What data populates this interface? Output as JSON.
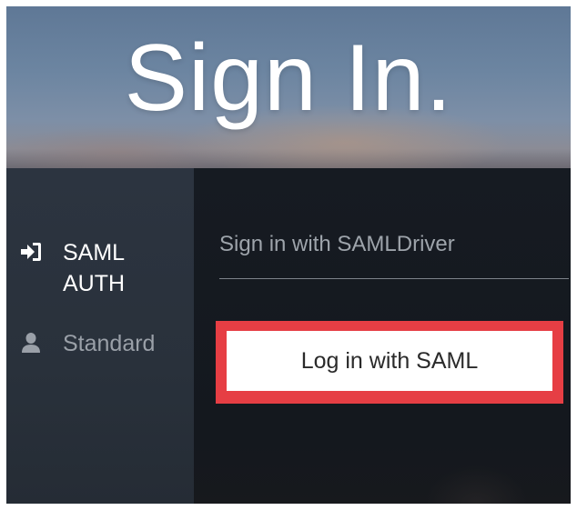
{
  "header": {
    "title": "Sign In."
  },
  "sidebar": {
    "items": [
      {
        "label": "SAML AUTH",
        "icon": "sign-in-icon",
        "active": true
      },
      {
        "label": "Standard",
        "icon": "user-icon",
        "active": false
      }
    ]
  },
  "main": {
    "subtitle": "Sign in with SAMLDriver",
    "login_button_label": "Log in with SAML"
  },
  "colors": {
    "highlight_border": "#e63e44",
    "sidebar_bg": "#2c3440",
    "main_bg": "#161b22",
    "active_text": "#ffffff",
    "inactive_text": "#9aa0a8"
  }
}
